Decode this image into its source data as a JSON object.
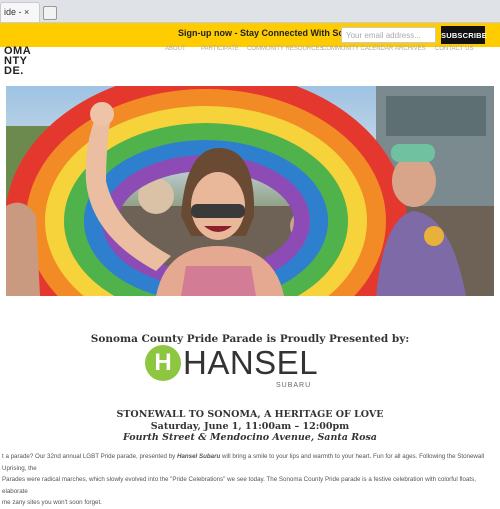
{
  "browser": {
    "tab_title": "ide - ×",
    "tab_close": "×"
  },
  "signup_bar": {
    "text": "Sign-up now - Stay Connected With Sonoma County Pride!",
    "email_placeholder": "Your email address...",
    "subscribe_label": "SUBSCRIBE"
  },
  "header": {
    "logo_lines": [
      "OMA",
      "NTY",
      "DE."
    ],
    "nav": [
      "ABOUT",
      "PARTICIPATE",
      "COMMUNITY RESOURCES",
      "COMMUNITY CALENDAR",
      "ARCHIVES",
      "CONTACT US"
    ]
  },
  "hero": {
    "image": "parade-participant-in-rainbow-arch"
  },
  "sponsor": {
    "presented_by": "Sonoma County Pride Parade is Proudly Presented by:",
    "logo_letter": "H",
    "logo_name": "HANSEL",
    "logo_sub": "SUBARU",
    "brand_color": "#8dc63f"
  },
  "event": {
    "title": "STONEWALL TO SONOMA, A HERITAGE OF LOVE",
    "date": "Saturday, June 1, 11:00am – 12:00pm",
    "place": "Fourth Street & Mendocino Avenue, Santa Rosa"
  },
  "intro": {
    "line1_a": "t a parade? Our 32nd annual LGBT Pride parade, presented by ",
    "line1_sponsor": "Hansel Subaru",
    "line1_b": " will bring a smile to your lips and warmth to your heart. Fun for all ages. Following the Stonewall Uprising, the",
    "line2": "Parades were radical marches, which slowly evolved into the \"Pride Celebrations\" we see today. The Sonoma County Pride parade is a festive celebration with colorful floats, elaborate",
    "line3": "me zany sites you won't soon forget."
  }
}
